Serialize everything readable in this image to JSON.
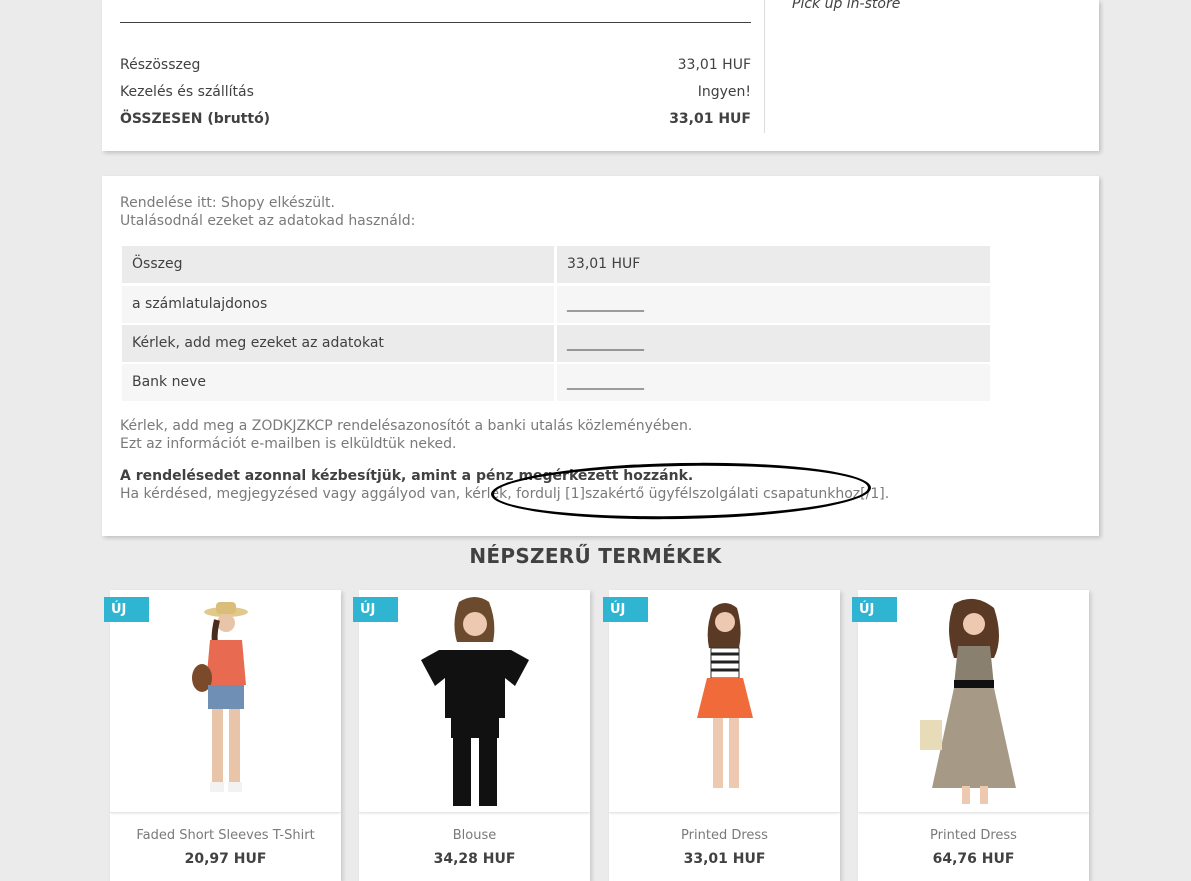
{
  "totals": {
    "rows": [
      {
        "label": "Részösszeg",
        "value": "33,01 HUF"
      },
      {
        "label": "Kezelés és szállítás",
        "value": "Ingyen!"
      },
      {
        "label": "ÖSSZESEN (bruttó)",
        "value": "33,01 HUF"
      }
    ],
    "shipping_method": "Pick up in-store"
  },
  "payment": {
    "intro_line1": "Rendelése itt: Shopy elkészült.",
    "intro_line2": "Utalásodnál ezeket az adatokad használd:",
    "table": [
      {
        "label": "Összeg",
        "value": "33,01 HUF"
      },
      {
        "label": "a számlatulajdonos",
        "value": "___________"
      },
      {
        "label": "Kérlek, add meg ezeket az adatokat",
        "value": "___________"
      },
      {
        "label": "Bank neve",
        "value": "___________"
      }
    ],
    "reference_line": "Kérlek, add meg a ZODKJZKCP rendelésazonosítót a banki utalás közleményében.",
    "email_line": "Ezt az információt e-mailben is elküldtük neked.",
    "ship_notice": "A rendelésedet azonnal kézbesítjük, amint a pénz megérkezett hozzánk.",
    "support_line": "Ha kérdésed, megjegyzésed vagy aggályod van, kérlek, fordulj [1]szakértő ügyfélszolgálati csapatunkhoz[/1]."
  },
  "popular": {
    "title": "NÉPSZERŰ TERMÉKEK",
    "products": [
      {
        "flag": "ÚJ",
        "name": "Faded Short Sleeves T-Shirt",
        "price": "20,97 HUF"
      },
      {
        "flag": "ÚJ",
        "name": "Blouse",
        "price": "34,28 HUF"
      },
      {
        "flag": "ÚJ",
        "name": "Printed Dress",
        "price": "33,01 HUF"
      },
      {
        "flag": "ÚJ",
        "name": "Printed Dress",
        "price": "64,76 HUF"
      }
    ]
  },
  "colors": {
    "flag": "#2fb5d2",
    "heading": "#414141",
    "muted": "#7a7a7a",
    "background": "#ebebeb"
  }
}
